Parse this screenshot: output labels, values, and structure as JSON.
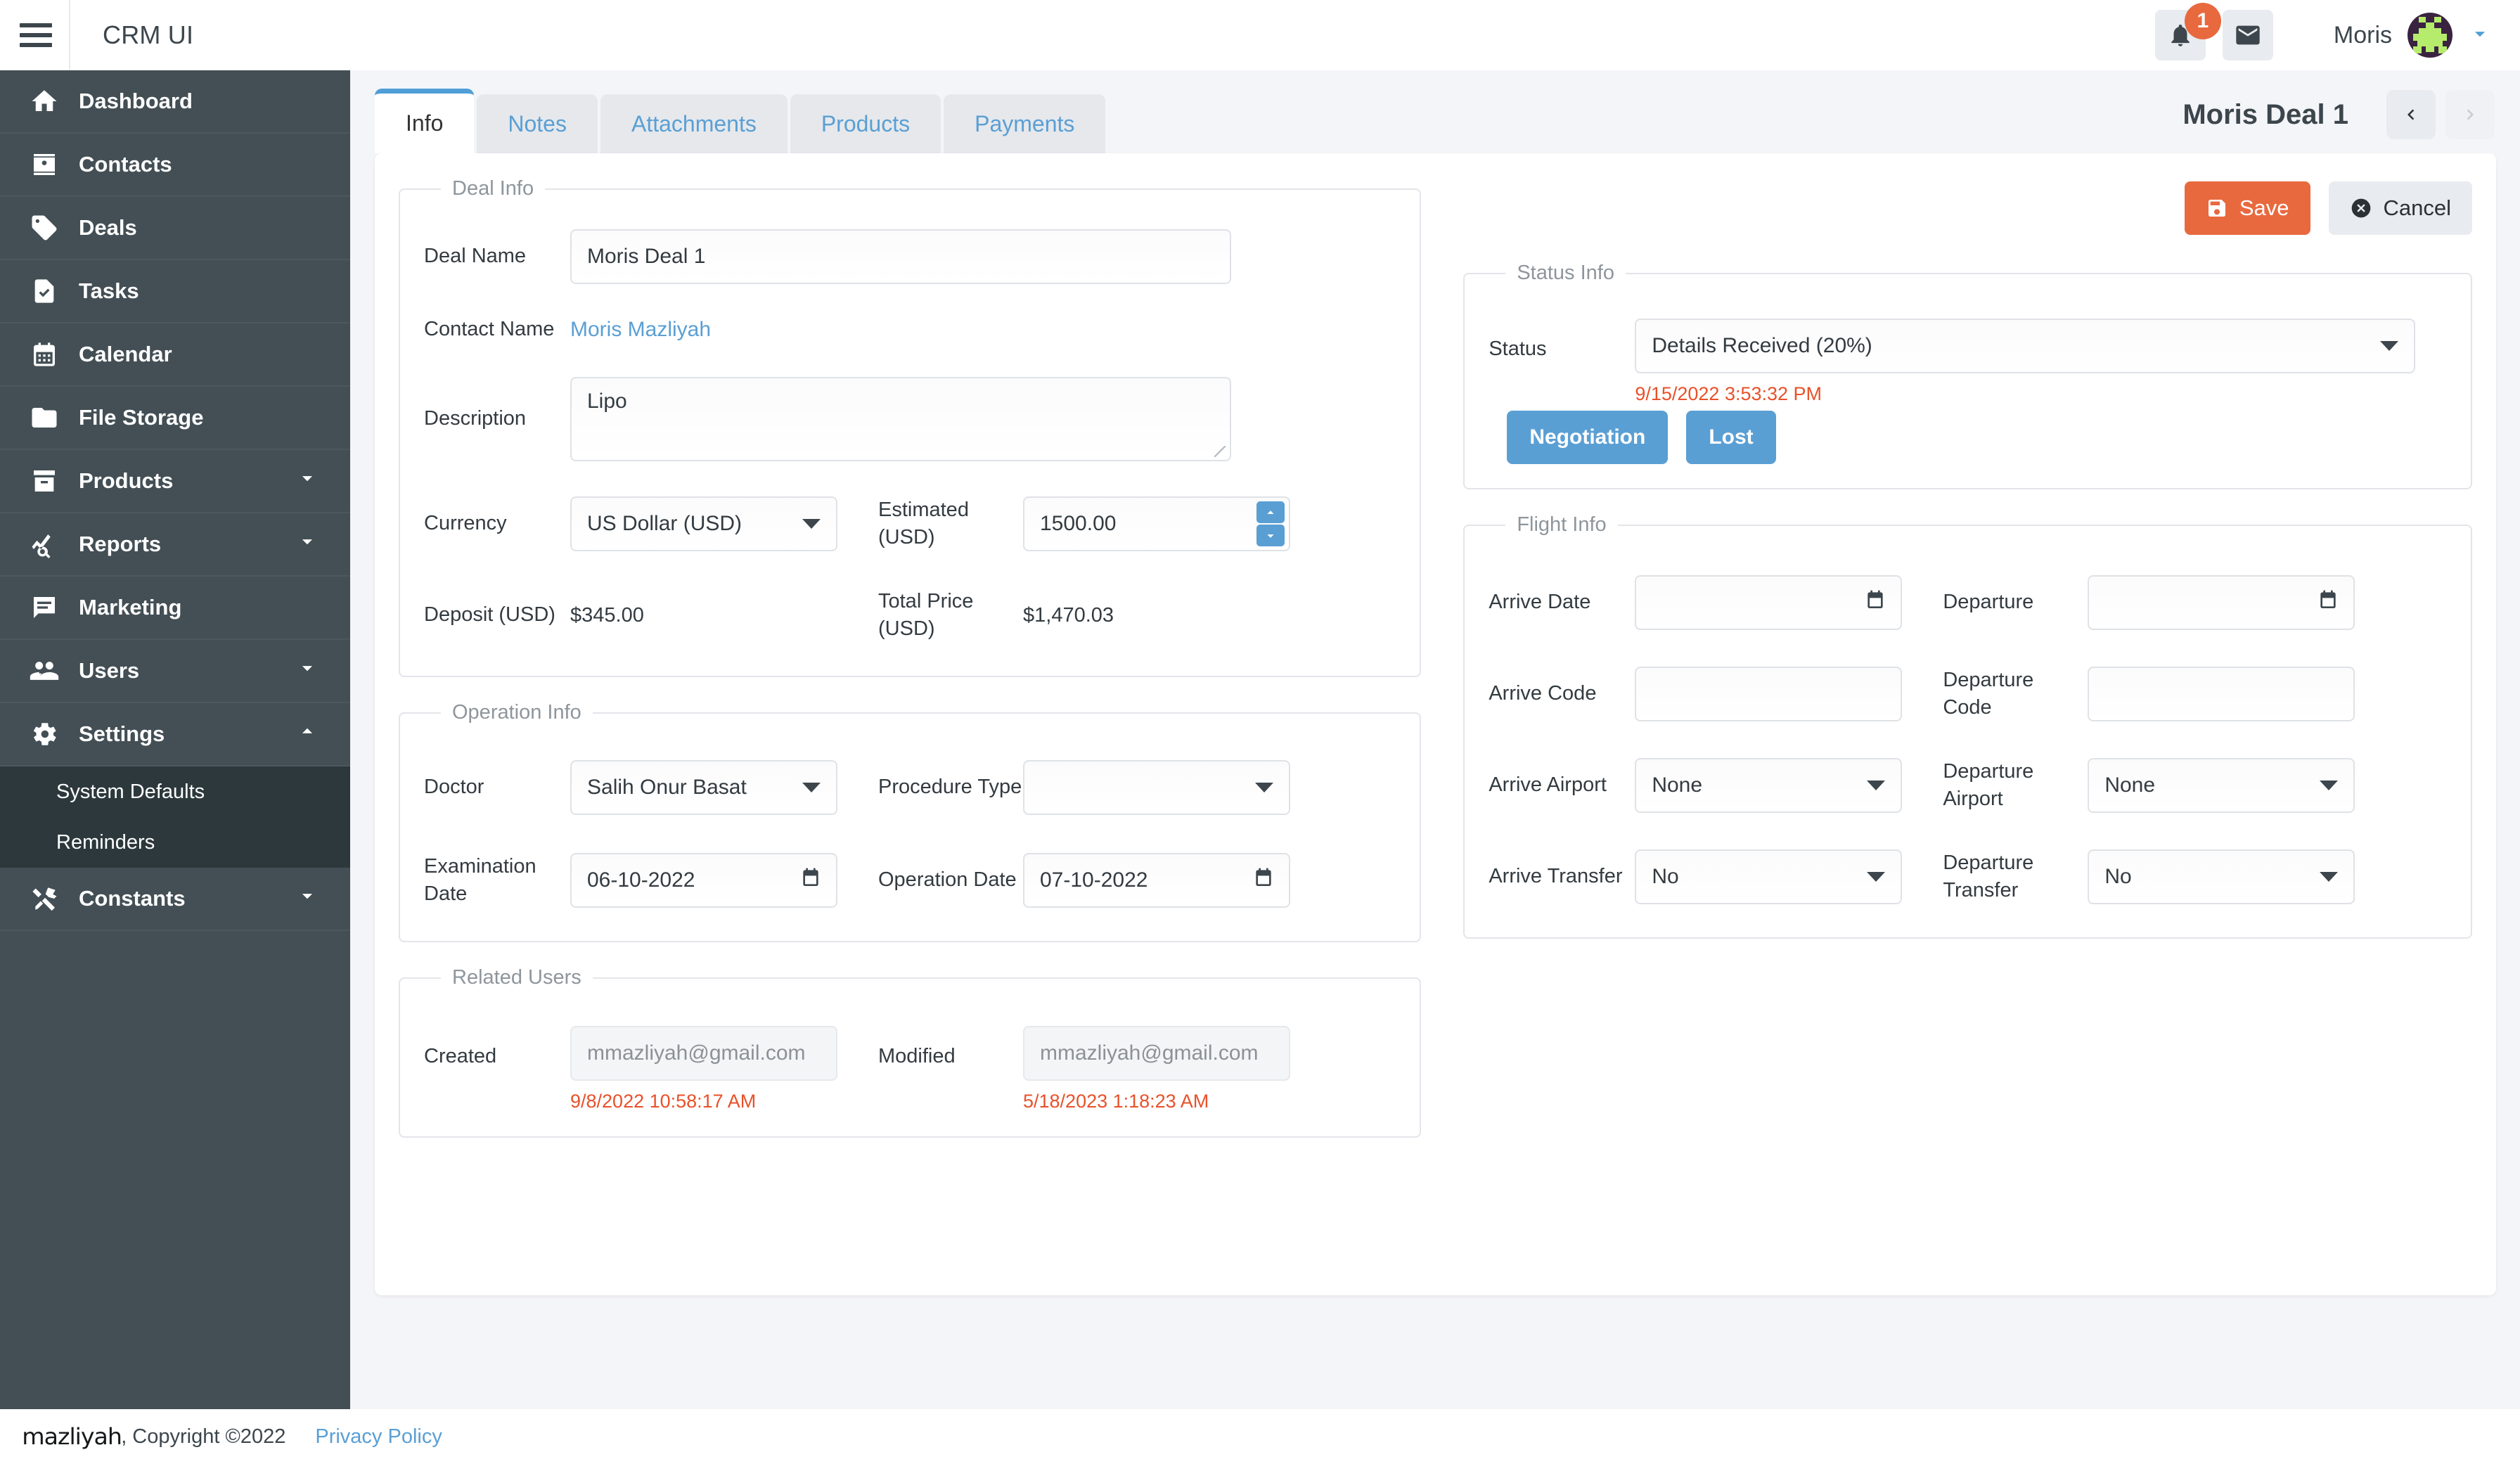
{
  "header": {
    "app_title": "CRM UI",
    "menu_icon": "hamburger-icon",
    "notification_count": "1",
    "user_name": "Moris"
  },
  "sidebar": {
    "items": [
      {
        "label": "Dashboard",
        "icon": "home-icon",
        "expandable": false
      },
      {
        "label": "Contacts",
        "icon": "contact-card-icon",
        "expandable": false
      },
      {
        "label": "Deals",
        "icon": "tag-icon",
        "expandable": false
      },
      {
        "label": "Tasks",
        "icon": "task-doc-icon",
        "expandable": false
      },
      {
        "label": "Calendar",
        "icon": "calendar-icon",
        "expandable": false
      },
      {
        "label": "File Storage",
        "icon": "folder-icon",
        "expandable": false
      },
      {
        "label": "Products",
        "icon": "archive-icon",
        "expandable": true
      },
      {
        "label": "Reports",
        "icon": "analytics-icon",
        "expandable": true
      },
      {
        "label": "Marketing",
        "icon": "chat-icon",
        "expandable": false
      },
      {
        "label": "Users",
        "icon": "people-icon",
        "expandable": true
      },
      {
        "label": "Settings",
        "icon": "gear-icon",
        "expandable": true
      }
    ],
    "settings_submenu": [
      {
        "label": "System Defaults"
      },
      {
        "label": "Reminders"
      }
    ],
    "constants": {
      "label": "Constants",
      "icon": "tools-icon",
      "expandable": true
    }
  },
  "tabs": [
    {
      "label": "Info",
      "active": true
    },
    {
      "label": "Notes",
      "active": false
    },
    {
      "label": "Attachments",
      "active": false
    },
    {
      "label": "Products",
      "active": false
    },
    {
      "label": "Payments",
      "active": false
    }
  ],
  "page": {
    "title": "Moris Deal 1",
    "prev_label": "‹",
    "next_label": "›"
  },
  "toolbar": {
    "save_label": "Save",
    "cancel_label": "Cancel"
  },
  "deal_info": {
    "legend": "Deal Info",
    "deal_name_label": "Deal Name",
    "deal_name_value": "Moris Deal 1",
    "contact_name_label": "Contact Name",
    "contact_name_value": "Moris Mazliyah",
    "description_label": "Description",
    "description_value": "Lipo",
    "currency_label": "Currency",
    "currency_value": "US Dollar (USD)",
    "estimated_label": "Estimated (USD)",
    "estimated_value": "1500.00",
    "deposit_label": "Deposit (USD)",
    "deposit_value": "$345.00",
    "total_price_label": "Total Price (USD)",
    "total_price_value": "$1,470.03"
  },
  "operation_info": {
    "legend": "Operation Info",
    "doctor_label": "Doctor",
    "doctor_value": "Salih Onur Basat",
    "procedure_type_label": "Procedure Type",
    "procedure_type_value": "",
    "examination_date_label": "Examination Date",
    "examination_date_value": "06-10-2022",
    "operation_date_label": "Operation Date",
    "operation_date_value": "07-10-2022"
  },
  "related_users": {
    "legend": "Related Users",
    "created_label": "Created",
    "created_value": "mmazliyah@gmail.com",
    "created_timestamp": "9/8/2022 10:58:17 AM",
    "modified_label": "Modified",
    "modified_value": "mmazliyah@gmail.com",
    "modified_timestamp": "5/18/2023 1:18:23 AM"
  },
  "status_info": {
    "legend": "Status Info",
    "status_label": "Status",
    "status_value": "Details Received (20%)",
    "status_timestamp": "9/15/2022 3:53:32 PM",
    "negotiation_label": "Negotiation",
    "lost_label": "Lost"
  },
  "flight_info": {
    "legend": "Flight Info",
    "arrive_date_label": "Arrive Date",
    "arrive_date_value": "",
    "departure_label": "Departure",
    "departure_value": "",
    "arrive_code_label": "Arrive Code",
    "arrive_code_value": "",
    "departure_code_label": "Departure Code",
    "departure_code_value": "",
    "arrive_airport_label": "Arrive Airport",
    "arrive_airport_value": "None",
    "departure_airport_label": "Departure Airport",
    "departure_airport_value": "None",
    "arrive_transfer_label": "Arrive Transfer",
    "arrive_transfer_value": "No",
    "departure_transfer_label": "Departure Transfer",
    "departure_transfer_value": "No"
  },
  "footer": {
    "logo_text": "mazliyah",
    "copyright": ", Copyright ©2022",
    "privacy_label": "Privacy Policy"
  },
  "colors": {
    "sidebar_bg": "#434f55",
    "submenu_bg": "#2c383c",
    "accent_blue": "#5a9fd4",
    "accent_orange": "#e8693e",
    "timestamp_red": "#e8512a",
    "page_bg": "#f4f5f8"
  }
}
